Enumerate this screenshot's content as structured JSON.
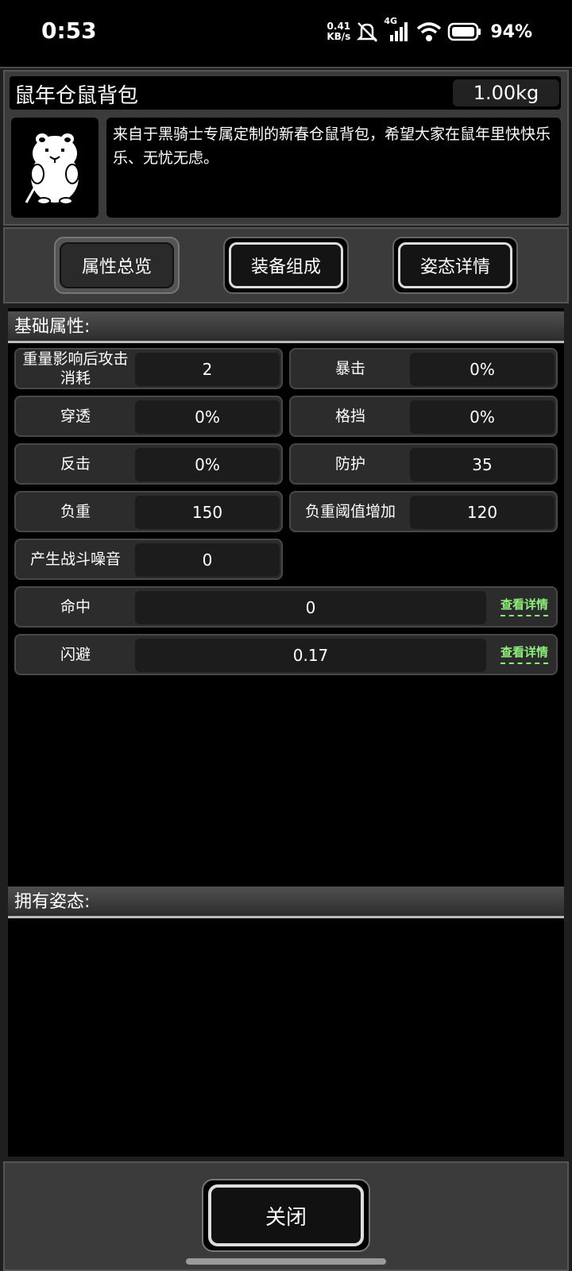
{
  "status_bar": {
    "time": "0:53",
    "net_speed_value": "0.41",
    "net_speed_unit": "KB/s",
    "network_type": "4G",
    "battery": "94%"
  },
  "item": {
    "name": "鼠年仓鼠背包",
    "weight": "1.00kg",
    "description": "来自于黑骑士专属定制的新春仓鼠背包，希望大家在鼠年里快快乐乐、无忧无虑。",
    "icon": "hamster-icon"
  },
  "tabs": [
    {
      "label": "属性总览",
      "active": true
    },
    {
      "label": "装备组成",
      "active": false
    },
    {
      "label": "姿态详情",
      "active": false
    }
  ],
  "base_section": {
    "title": "基础属性:",
    "stats": [
      {
        "label": "重量影响后攻击消耗",
        "value": "2"
      },
      {
        "label": "暴击",
        "value": "0%"
      },
      {
        "label": "穿透",
        "value": "0%"
      },
      {
        "label": "格挡",
        "value": "0%"
      },
      {
        "label": "反击",
        "value": "0%"
      },
      {
        "label": "防护",
        "value": "35"
      },
      {
        "label": "负重",
        "value": "150"
      },
      {
        "label": "负重阈值增加",
        "value": "120"
      },
      {
        "label": "产生战斗噪音",
        "value": "0"
      }
    ],
    "wide_stats": [
      {
        "label": "命中",
        "value": "0",
        "link": "查看详情"
      },
      {
        "label": "闪避",
        "value": "0.17",
        "link": "查看详情"
      }
    ]
  },
  "stance_section": {
    "title": "拥有姿态:"
  },
  "close_label": "关闭",
  "colors": {
    "link_green": "#8ef07a",
    "panel_bg": "#000000",
    "frame_bg": "#3a3b3a"
  }
}
